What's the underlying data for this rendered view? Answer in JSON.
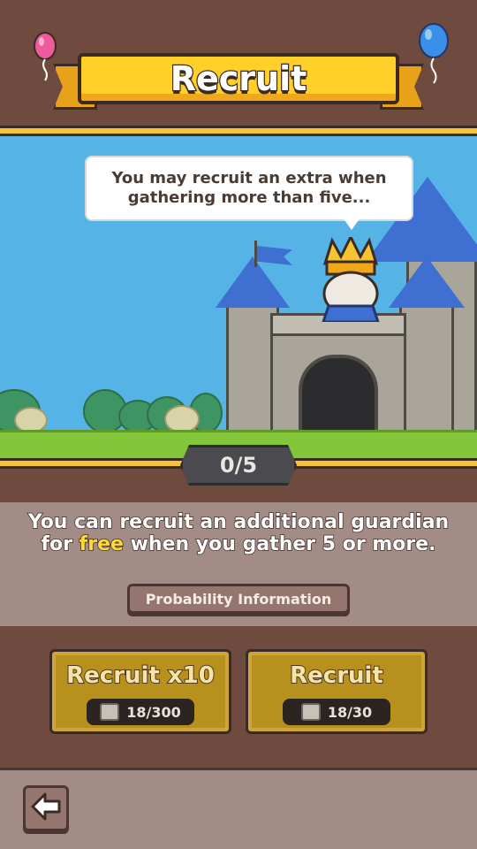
{
  "header": {
    "title": "Recruit",
    "balloons": [
      {
        "name": "pink-balloon-icon",
        "color": "#ee5a9c"
      },
      {
        "name": "blue-balloon-icon",
        "color": "#3a8fe6"
      }
    ]
  },
  "scene": {
    "speech_bubble": "You may recruit an extra when gathering more than five..."
  },
  "counter": {
    "current": "0",
    "total": "5",
    "text": "0/5"
  },
  "info": {
    "line_before": "You can recruit an additional guardian for ",
    "highlight": "free",
    "line_after": " when you gather 5 or more.",
    "probability_button": "Probability Information"
  },
  "buttons": {
    "recruit_x10": {
      "label": "Recruit x10",
      "cost": "18/300",
      "icon": "scroll-icon"
    },
    "recruit": {
      "label": "Recruit",
      "cost": "18/30",
      "icon": "scroll-icon"
    }
  },
  "footer": {
    "back_icon": "back-arrow-icon"
  },
  "colors": {
    "gold": "#f7c431",
    "panel": "#a48c86",
    "background": "#6e4b3e",
    "sky": "#55b3e6",
    "highlight": "#ffd83a"
  }
}
